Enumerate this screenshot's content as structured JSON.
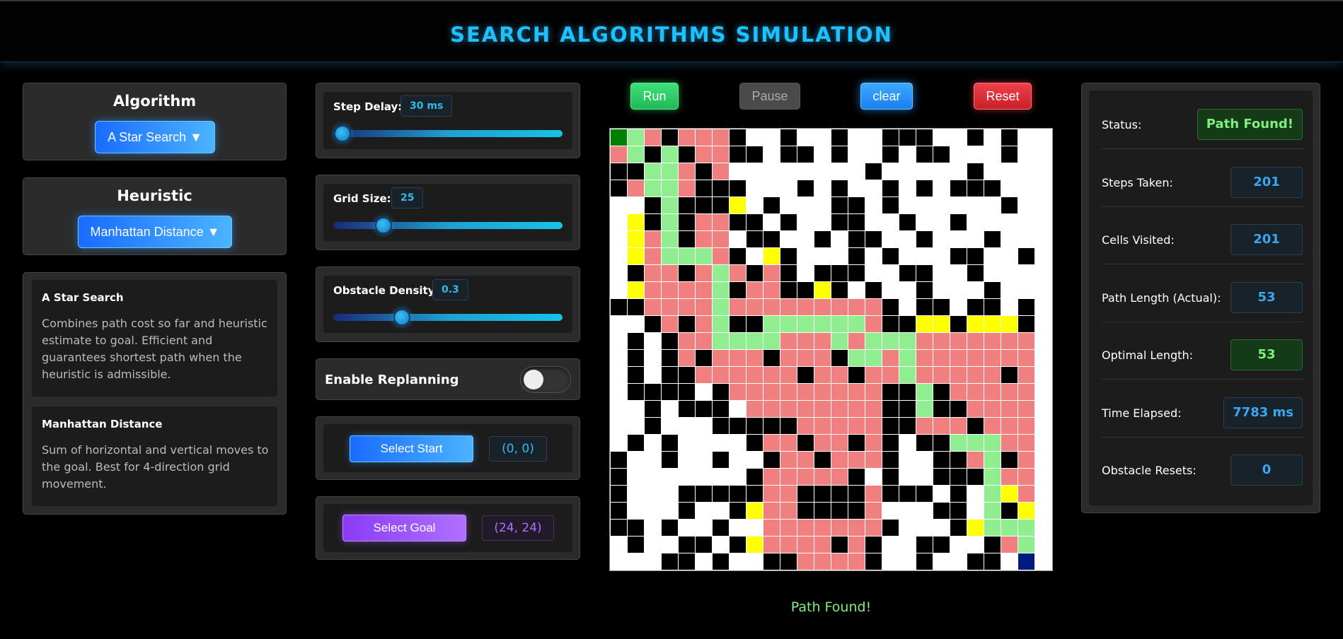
{
  "header": {
    "title": "SEARCH ALGORITHMS SIMULATION"
  },
  "algorithm": {
    "title": "Algorithm",
    "selected": "A Star Search ▼"
  },
  "heuristic": {
    "title": "Heuristic",
    "selected": "Manhattan Distance ▼"
  },
  "descriptions": {
    "algorithm": {
      "title": "A Star Search",
      "text": "Combines path cost so far and heuristic estimate to goal. Efficient and guarantees shortest path when the heuristic is admissible."
    },
    "heuristic": {
      "title": "Manhattan Distance",
      "text": "Sum of horizontal and vertical moves to the goal. Best for 4-direction grid movement."
    }
  },
  "sliders": {
    "step_delay": {
      "label": "Step Delay:",
      "value": "30 ms",
      "fraction": 0.04
    },
    "grid_size": {
      "label": "Grid Size:",
      "value": "25",
      "fraction": 0.22
    },
    "obstacle_density": {
      "label": "Obstacle Density:",
      "value": "0.3",
      "fraction": 0.3
    }
  },
  "replanning": {
    "label": "Enable Replanning",
    "enabled": false
  },
  "select_start": {
    "label": "Select Start",
    "coord": "(0, 0)"
  },
  "select_goal": {
    "label": "Select Goal",
    "coord": "(24, 24)"
  },
  "controls": {
    "run": "Run",
    "pause": "Pause",
    "clear": "clear",
    "reset": "Reset"
  },
  "grid": {
    "size": 25,
    "legend": {
      "W": "#ffffff",
      "B": "#000000",
      "R": "#f08080",
      "G": "#90ee90",
      "Y": "#ffff00",
      "S": "#008000",
      "E": "#001a80"
    },
    "rows": [
      "SGRBRRRBWWBWWBWWBBBWWBWBW",
      "RGBGBRRBBWBBWBWWBWBBWWWBW",
      "BBGGRBRWWWWWWWWBWWWWWBWWW",
      "BRGGRBBBWWWBWBWWBWBWBBBWW",
      "WWBGBBBYWBWWWBBWBWWWWWWBW",
      "WYBGBRRBBWBWWBBWWBWWBWWWW",
      "WYRGBRRWBBWWBWBBWWBWWWBWW",
      "WYRGGGRBWYBWWWBWBWWWBBWWB",
      "WBRRBRGRBRBWBBBWWBBWWBWWW",
      "WYRRRRGBRRBBYBWBWWBWWWBWW",
      "BBRRRRGRRRRRRRRRBWBBWBBWB",
      "WWBRBRGBBGGGGGGRBBYYBYYYB",
      "WBWBRRGGGGRRRGRGGGRRRRRRR",
      "WBWBRBRRRBRRRBGGRGRRRRRRR",
      "WBWBBRRRRRRBRRBRRGRRRRRBR",
      "WBBBBWBRRRRRRRRRBBGBRRRRR",
      "WWBWBBBWRRRRRRRRBBGBBRRRR",
      "WWBWWWBBBBBRRRRRBBRRRBRRR",
      "WBWBWWWWBRRBRRBRBWBBGGGRR",
      "BWWBWWBWWBRRBRRRBWWBBRGBR",
      "BWWWWWWWBRRRRRBWBWWBBBGRR",
      "BWWWBBBBBRRBBBBRBBBWBWGYR",
      "BWWWBWWBYRRBBBBRWWWBBWGBY",
      "BBWBWWBWWRRRRRRRBWWWBYGGG",
      "WBWWBBWBYRRRRBRBWWBBWWBRG",
      "WWWBBWBWWBBRRRRBWWBWWBBWE"
    ]
  },
  "status_message": "Path Found!",
  "stats": [
    {
      "label": "Status:",
      "value": "Path Found!",
      "tone": "green"
    },
    {
      "label": "Steps Taken:",
      "value": "201",
      "tone": "blue"
    },
    {
      "label": "Cells Visited:",
      "value": "201",
      "tone": "blue"
    },
    {
      "label": "Path Length (Actual):",
      "value": "53",
      "tone": "blue"
    },
    {
      "label": "Optimal Length:",
      "value": "53",
      "tone": "green"
    },
    {
      "label": "Time Elapsed:",
      "value": "7783 ms",
      "tone": "blue"
    },
    {
      "label": "Obstacle Resets:",
      "value": "0",
      "tone": "blue"
    }
  ]
}
